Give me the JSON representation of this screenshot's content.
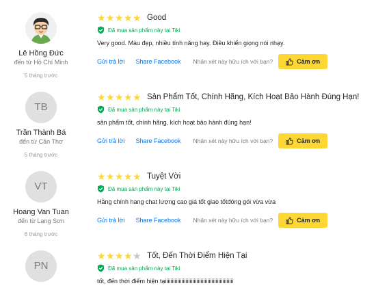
{
  "ui": {
    "bought_label": "Đã mua sản phẩm này tại Tiki",
    "reply_label": "Gửi trả lời",
    "share_label": "Share Facebook",
    "helpful_question": "Nhận xét này hữu ích với bạn?",
    "thanks_label": "Cảm ơn",
    "colors": {
      "star": "#fdd836",
      "green": "#00ab56",
      "link": "#0b74e5",
      "button": "#fdd835"
    }
  },
  "reviews": [
    {
      "user_name": "Lê Hồng Đức",
      "location": "đến từ Hồ Chí Minh",
      "time": "5 tháng trước",
      "avatar": "",
      "rating": 5,
      "title": "Good",
      "content": "Very good. Màu đẹp, nhiều tính năng hay. Điều khiển giọng nói nhạy."
    },
    {
      "user_name": "Trần Thành Bá",
      "location": "đến từ Cần Thơ",
      "time": "5 tháng trước",
      "avatar": "TB",
      "rating": 5,
      "title": "Sản Phẩm Tốt, Chính Hãng, Kích Hoạt Bảo Hành Đúng Hạn!",
      "content": "sản phẩm tốt, chính hãng, kích hoạt bảo hành đúng hạn!"
    },
    {
      "user_name": "Hoang Van Tuan",
      "location": "đến từ Lạng Sơn",
      "time": "6 tháng trước",
      "avatar": "VT",
      "rating": 5,
      "title": "Tuyệt Vời",
      "content": "Hằng chính hang chat lượng cao giá tốt giao tốtđóng gói vừa vừa"
    },
    {
      "user_name": "",
      "location": "",
      "time": "",
      "avatar": "PN",
      "rating": 4,
      "title": "Tốt, Đến Thời Điểm Hiện Tại",
      "content": "tốt, đến thời điểm hiện tạiiiiiiiiiiiiiiiiiiiiiiiiiiiiiiiiiiiiiiiiiiiiiiiiii"
    }
  ]
}
